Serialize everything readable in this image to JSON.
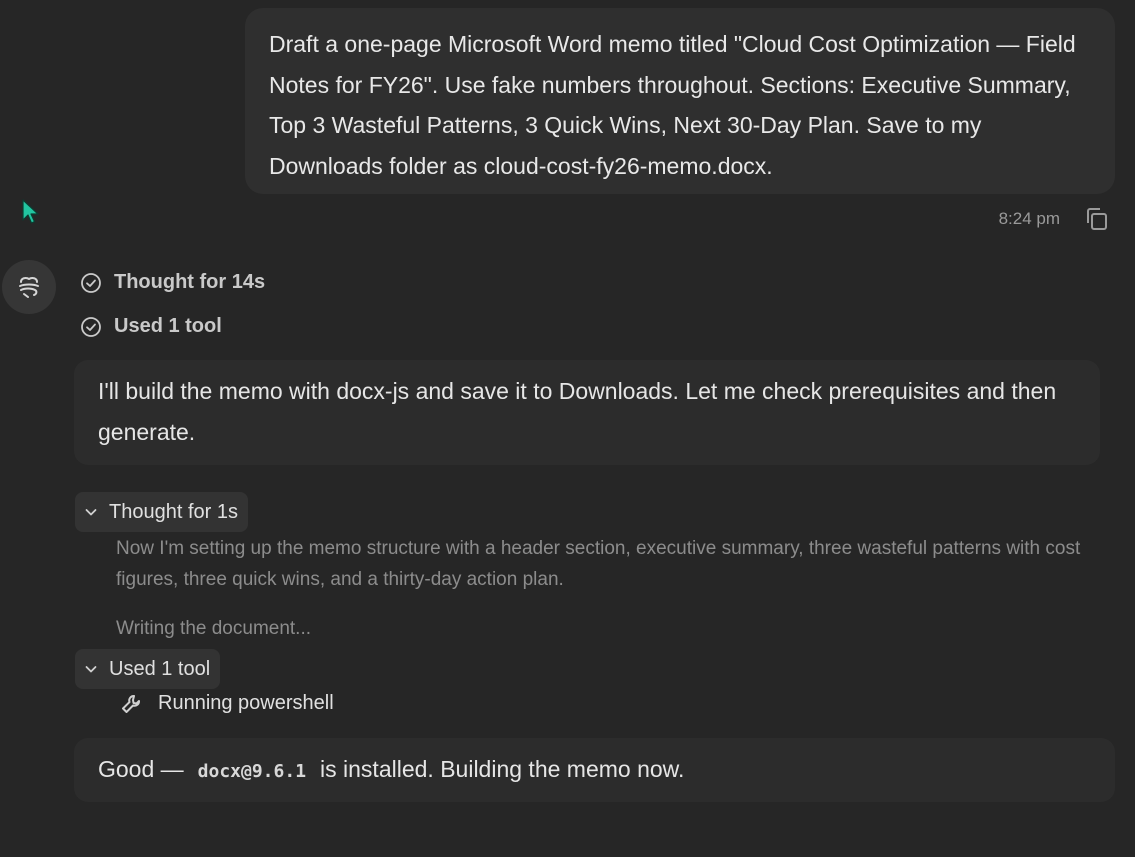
{
  "user_message": {
    "text": "Draft a one-page Microsoft Word memo titled \"Cloud Cost Optimization — Field Notes for FY26\". Use fake numbers throughout. Sections: Executive Summary, Top 3 Wasteful Patterns, 3 Quick Wins, Next 30-Day Plan. Save to my Downloads folder as cloud-cost-fy26-memo.docx.",
    "time": "8:24 pm"
  },
  "assistant": {
    "status_thought": "Thought for 14s",
    "status_tool": "Used 1 tool",
    "reply_1": "I'll build the memo with docx-js and save it to Downloads. Let me check prerequisites and then generate.",
    "thought_toggle": "Thought for 1s",
    "thought_text": "Now I'm setting up the memo structure with a header section, executive summary, three wasteful patterns with cost figures, three quick wins, and a thirty-day action plan.",
    "writing_text": "Writing the document...",
    "tool_toggle": "Used 1 tool",
    "tool_running": "Running powershell",
    "reply_2_before": "Good —",
    "reply_2_code": "docx@9.6.1",
    "reply_2_after": "is installed. Building the memo now."
  },
  "icons": {
    "copy": "copy-icon",
    "avatar": "assistant-logo-icon",
    "check": "check-circle-icon",
    "chevron": "chevron-down-icon",
    "wrench": "wrench-icon",
    "cursor": "mouse-cursor-icon"
  },
  "colors": {
    "background": "#262626",
    "user_bubble": "#2f2f2f",
    "assistant_box": "#2c2c2c",
    "cursor": "#22c5a0"
  }
}
